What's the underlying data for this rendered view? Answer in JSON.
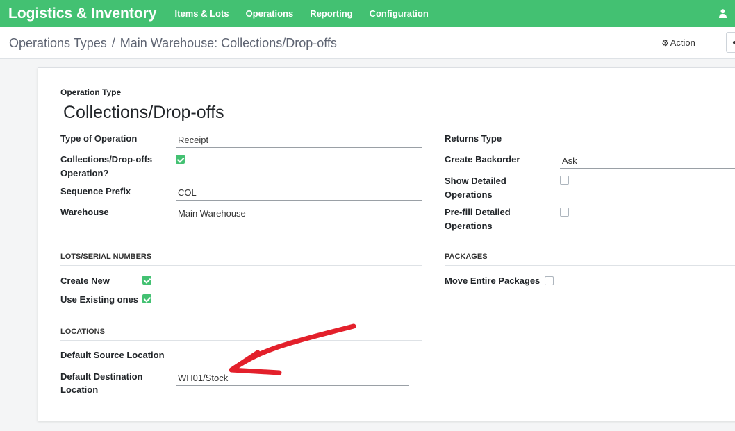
{
  "navbar": {
    "brand": "Logistics & Inventory",
    "items": [
      "Items & Lots",
      "Operations",
      "Reporting",
      "Configuration"
    ],
    "user_icon": "user-icon"
  },
  "control": {
    "breadcrumb_parent": "Operations Types",
    "breadcrumb_sep": "/",
    "breadcrumb_current": "Main Warehouse: Collections/Drop-offs",
    "action_label": "Action",
    "action_icon": "gear-icon"
  },
  "form": {
    "operation_type_label": "Operation Type",
    "operation_type_value": "Collections/Drop-offs",
    "left": {
      "type_of_operation_label": "Type of Operation",
      "type_of_operation_value": "Receipt",
      "collections_operation_label_1": "Collections/Drop-offs",
      "collections_operation_label_2": "Operation?",
      "collections_operation_checked": true,
      "sequence_prefix_label": "Sequence Prefix",
      "sequence_prefix_value": "COL",
      "warehouse_label": "Warehouse",
      "warehouse_value": "Main Warehouse"
    },
    "right": {
      "returns_type_label": "Returns Type",
      "create_backorder_label": "Create Backorder",
      "create_backorder_value": "Ask",
      "show_detailed_label_1": "Show Detailed",
      "show_detailed_label_2": "Operations",
      "show_detailed_checked": false,
      "prefill_detailed_label_1": "Pre-fill Detailed",
      "prefill_detailed_label_2": "Operations",
      "prefill_detailed_checked": false
    },
    "lots": {
      "section_title": "LOTS/SERIAL NUMBERS",
      "create_new_label": "Create New",
      "create_new_checked": true,
      "use_existing_label": "Use Existing ones",
      "use_existing_checked": true
    },
    "packages": {
      "section_title": "PACKAGES",
      "move_entire_label": "Move Entire Packages",
      "move_entire_checked": false
    },
    "locations": {
      "section_title": "LOCATIONS",
      "default_source_label": "Default Source Location",
      "default_source_value": "",
      "default_dest_label_1": "Default Destination",
      "default_dest_label_2": "Location",
      "default_dest_value": "WH01/Stock"
    }
  },
  "colors": {
    "navbar_bg": "#43c172",
    "checkbox_on": "#43c172",
    "annotation_arrow": "#e3202b"
  }
}
